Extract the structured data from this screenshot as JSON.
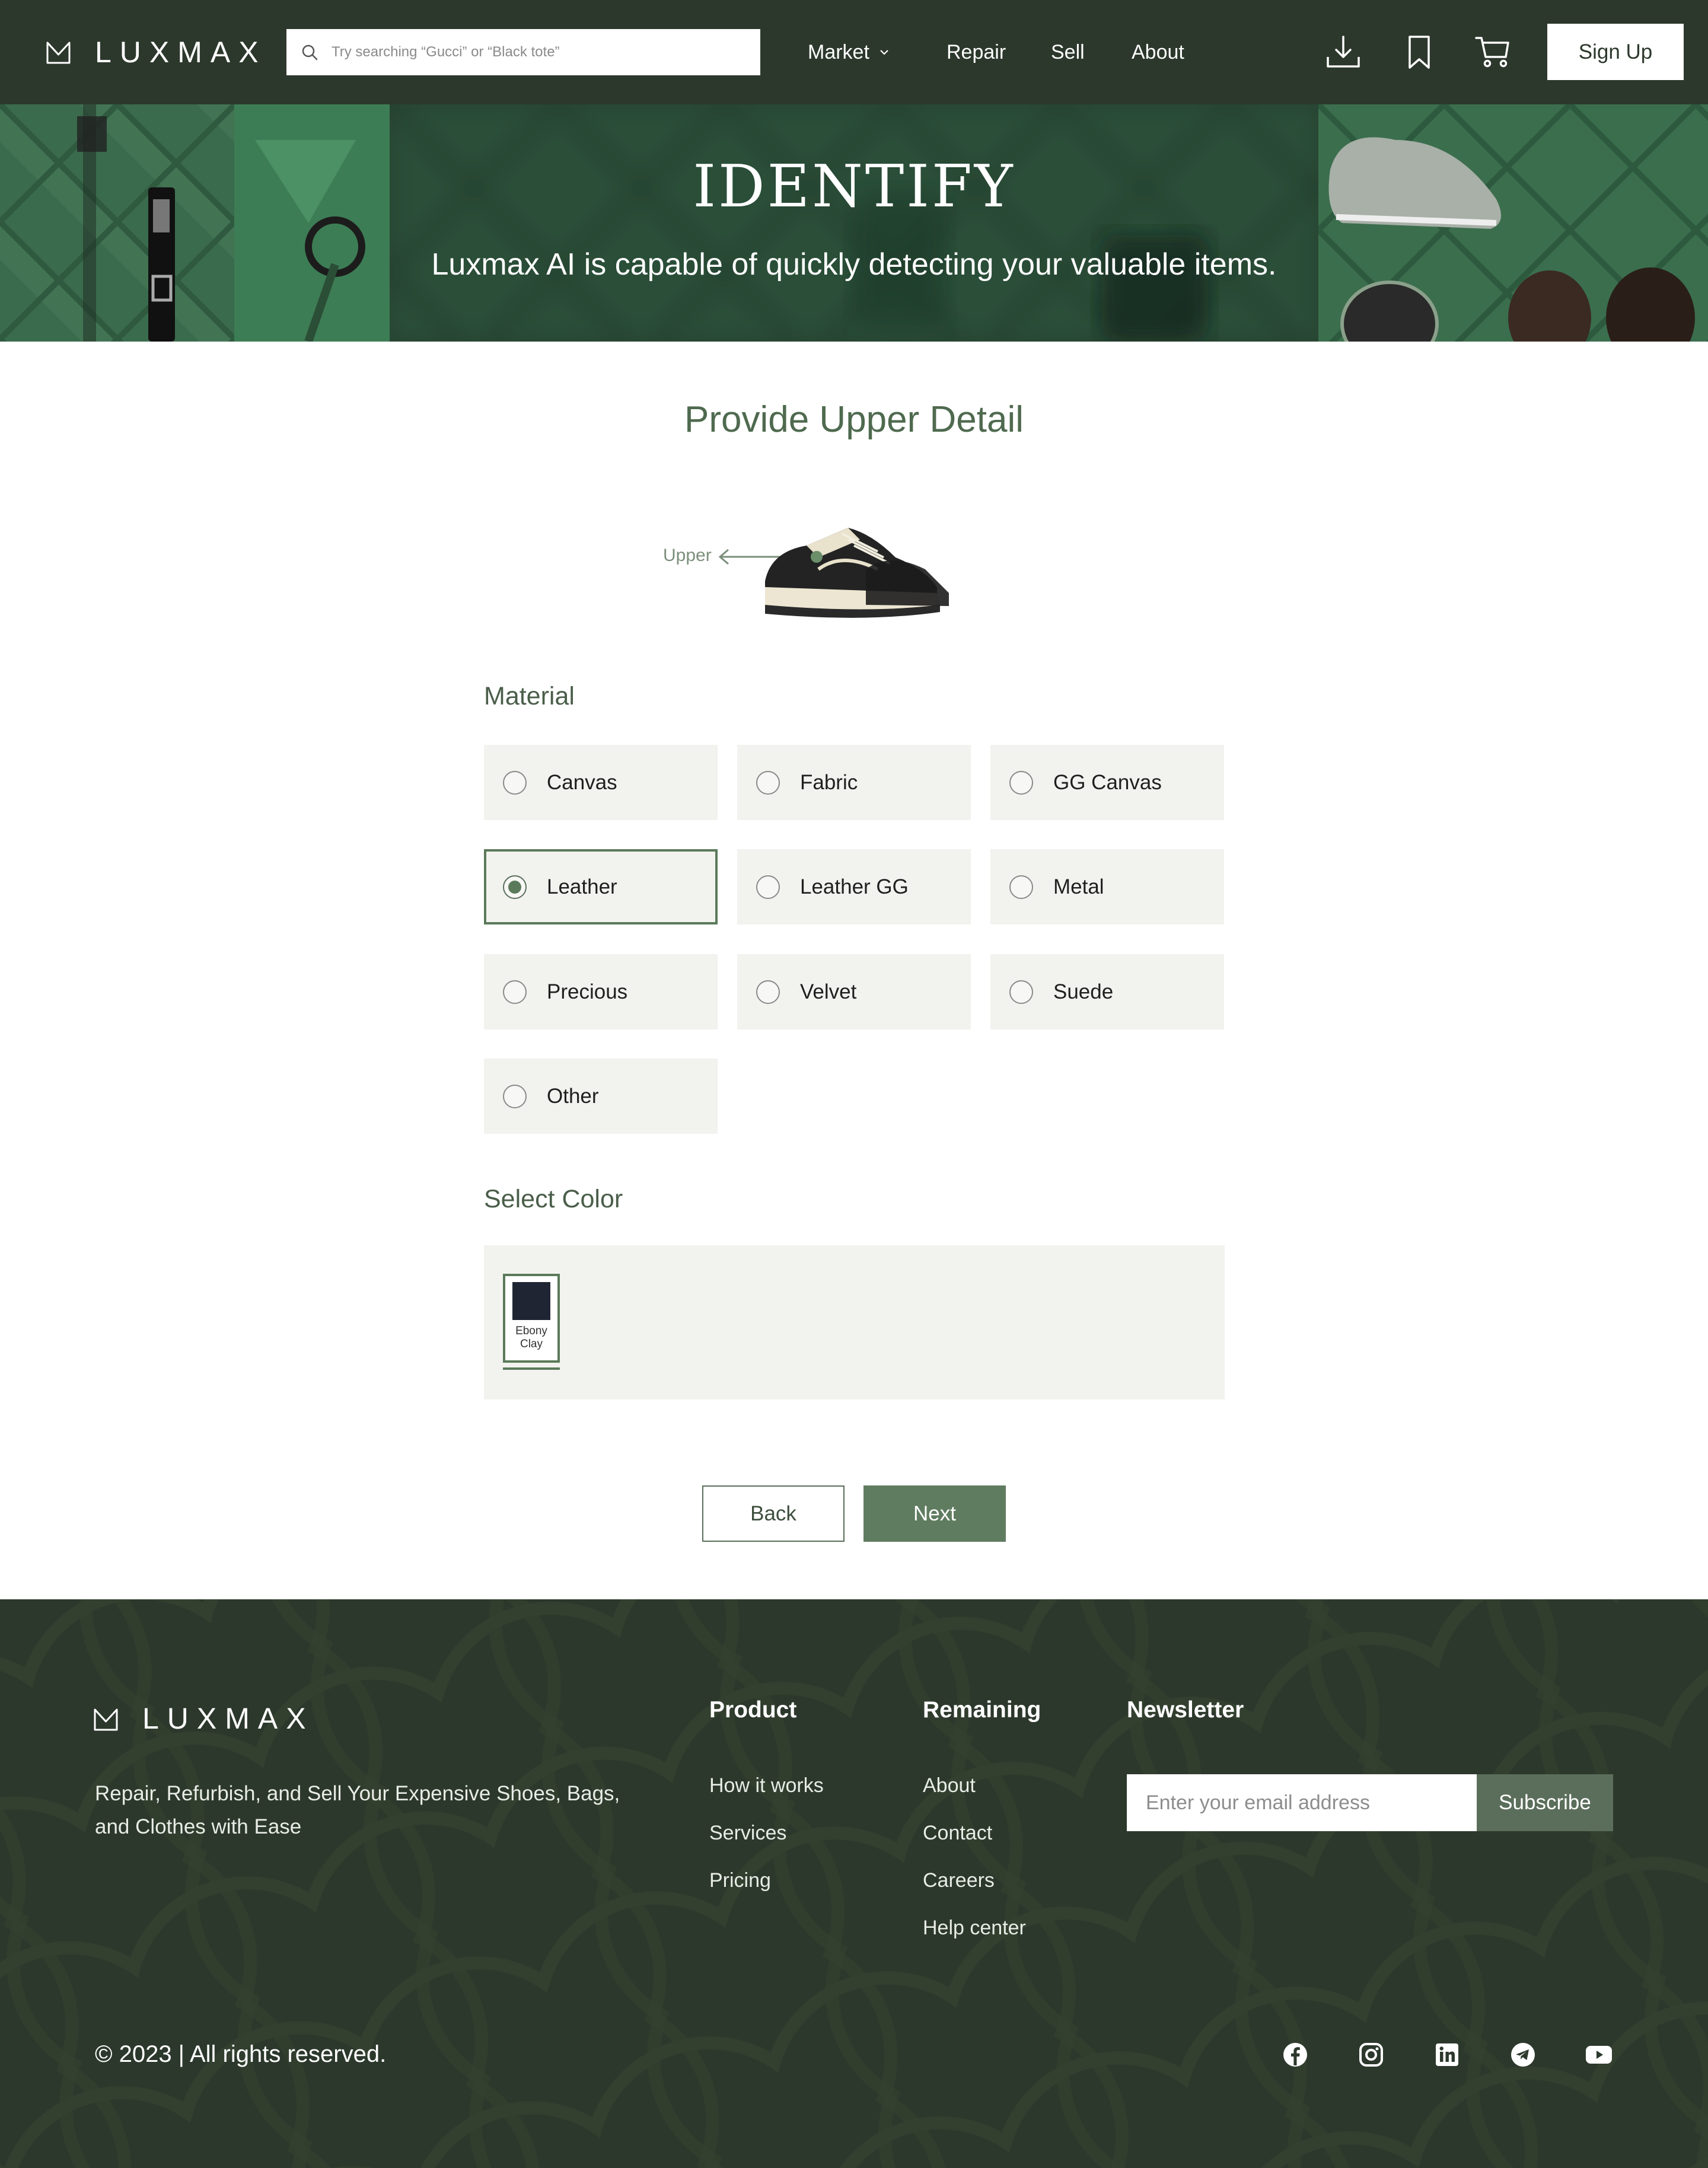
{
  "header": {
    "logo_text": "LUXMAX",
    "search_placeholder": "Try searching “Gucci” or “Black tote”",
    "nav": {
      "market": "Market",
      "repair": "Repair",
      "sell": "Sell",
      "about": "About"
    },
    "signup_label": "Sign Up"
  },
  "hero": {
    "title": "IDENTIFY",
    "subtitle": "Luxmax AI is capable of quickly detecting your valuable items."
  },
  "main": {
    "title": "Provide Upper Detail",
    "diagram_label": "Upper",
    "material_label": "Material",
    "materials": [
      {
        "label": "Canvas",
        "selected": false
      },
      {
        "label": "Fabric",
        "selected": false
      },
      {
        "label": "GG Canvas",
        "selected": false
      },
      {
        "label": "Leather",
        "selected": true
      },
      {
        "label": "Leather GG",
        "selected": false
      },
      {
        "label": "Metal",
        "selected": false
      },
      {
        "label": "Precious",
        "selected": false
      },
      {
        "label": "Velvet",
        "selected": false
      },
      {
        "label": "Suede",
        "selected": false
      },
      {
        "label": "Other",
        "selected": false
      }
    ],
    "color_label": "Select Color",
    "colors": [
      {
        "name_line1": "Ebony",
        "name_line2": "Clay",
        "hex": "#1f2533",
        "selected": true
      }
    ],
    "back_label": "Back",
    "next_label": "Next"
  },
  "footer": {
    "logo_text": "LUXMAX",
    "tagline": "Repair, Refurbish, and Sell Your Expensive Shoes, Bags, and Clothes with Ease",
    "product": {
      "heading": "Product",
      "links": [
        "How it works",
        "Services",
        "Pricing"
      ]
    },
    "remaining": {
      "heading": "Remaining",
      "links": [
        "About",
        "Contact",
        "Careers",
        "Help center"
      ]
    },
    "newsletter": {
      "heading": "Newsletter",
      "placeholder": "Enter your email address",
      "button": "Subscribe"
    },
    "copyright": "© 2023 |  All rights reserved.",
    "social_icons": [
      "facebook-icon",
      "instagram-icon",
      "linkedin-icon",
      "telegram-icon",
      "youtube-icon"
    ]
  },
  "colors": {
    "header_bg": "#2c382c",
    "accent": "#5b7a5b",
    "option_bg": "#f2f3ef"
  }
}
